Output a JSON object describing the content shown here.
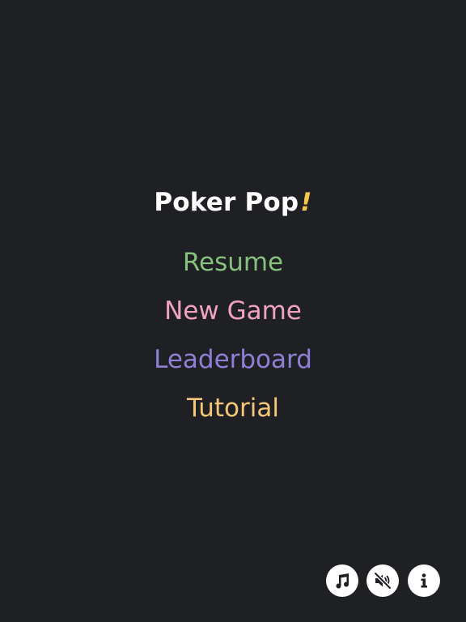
{
  "title": {
    "text": "Poker Pop",
    "exclamation": "!"
  },
  "menu": {
    "items": [
      {
        "label": "Resume",
        "color": "#86c17e"
      },
      {
        "label": "New Game",
        "color": "#f0a3c0"
      },
      {
        "label": "Leaderboard",
        "color": "#8d80d6"
      },
      {
        "label": "Tutorial",
        "color": "#f4c77a"
      }
    ]
  },
  "controls": {
    "music_icon": "music-note-icon",
    "sound_icon": "speaker-muted-icon",
    "info_icon": "info-icon"
  },
  "colors": {
    "background": "#1f2023",
    "title": "#ffffff",
    "accent": "#f3c74d"
  }
}
